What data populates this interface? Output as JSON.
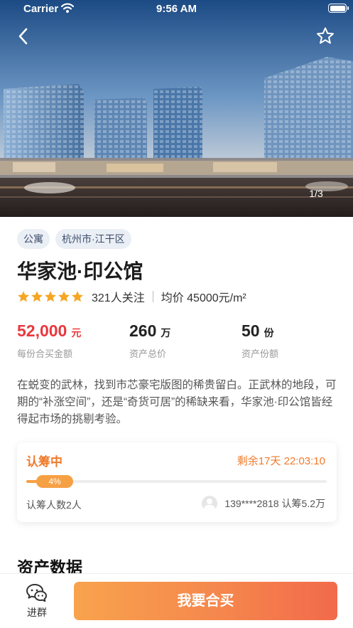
{
  "status_bar": {
    "carrier": "Carrier",
    "time": "9:56 AM"
  },
  "hero": {
    "pager": "1/3"
  },
  "tags": [
    "公寓",
    "杭州市·江干区"
  ],
  "title": "华家池·印公馆",
  "rating": {
    "stars": 5,
    "followers": "321人关注",
    "avg_price": "均价 45000元/m²"
  },
  "stats": [
    {
      "value": "52,000",
      "unit": "元",
      "label": "每份合买金额"
    },
    {
      "value": "260",
      "unit": "万",
      "label": "资产总价"
    },
    {
      "value": "50",
      "unit": "份",
      "label": "资产份额"
    }
  ],
  "description": "在蜕变的武林，找到市芯豪宅版图的稀贵留白。正武林的地段，可期的“补涨空间”，还是“奇货可居”的稀缺来看，华家池·印公馆皆经得起市场的挑剔考验。",
  "subscription": {
    "status": "认筹中",
    "remaining": "剩余17天 22:03:10",
    "progress": 0.04,
    "progress_label": "4%",
    "subscriber_count": "认筹人数2人",
    "latest": "139****2818 认筹5.2万"
  },
  "section_title": "资产数据",
  "bottom_bar": {
    "group_label": "进群",
    "buy_label": "我要合买"
  },
  "colors": {
    "accent": "#f07a2a",
    "price": "#e8383d",
    "tag_bg": "#eaeef5",
    "progress": "#f6a044"
  },
  "icons": [
    "back-arrow-icon",
    "star-outline-icon",
    "wifi-icon",
    "battery-icon",
    "chat-bubbles-icon",
    "user-avatar-icon"
  ]
}
